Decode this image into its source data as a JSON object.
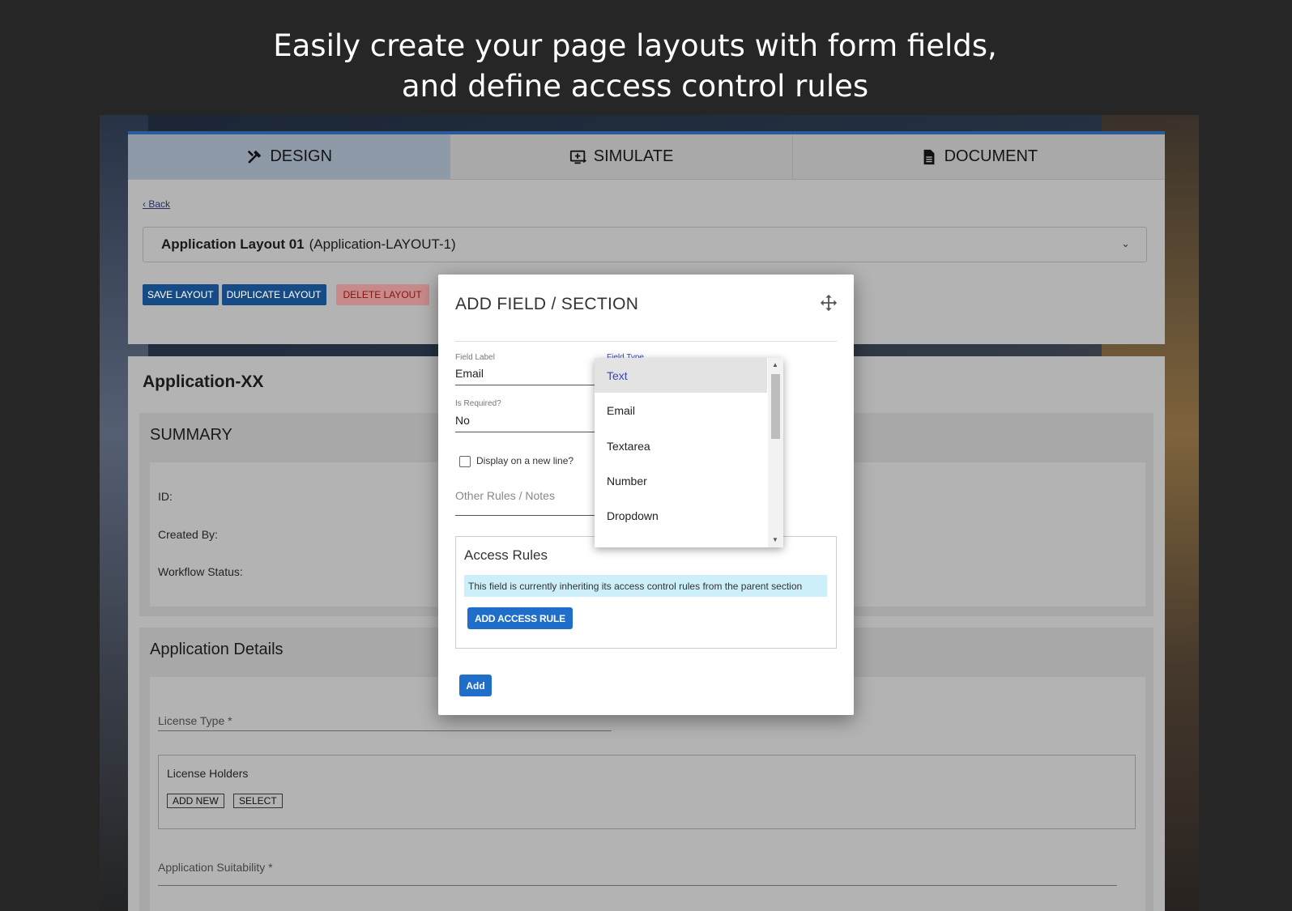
{
  "headline": {
    "line1": "Easily create your page layouts with form fields,",
    "line2": "and define access control rules"
  },
  "tabs": [
    {
      "label": "DESIGN",
      "icon": "design-tools-icon",
      "active": true
    },
    {
      "label": "SIMULATE",
      "icon": "simulate-screen-icon",
      "active": false
    },
    {
      "label": "DOCUMENT",
      "icon": "document-icon",
      "active": false
    }
  ],
  "back_link": "‹ Back",
  "layout_select": {
    "name": "Application Layout 01",
    "id": "(Application-LAYOUT-1)"
  },
  "layout_buttons": {
    "save": "SAVE LAYOUT",
    "duplicate": "DUPLICATE LAYOUT",
    "delete": "DELETE LAYOUT"
  },
  "application": {
    "title": "Application-XX",
    "summary": {
      "heading": "SUMMARY",
      "fields": [
        "ID:",
        "Created By:",
        "Workflow Status:"
      ]
    },
    "details": {
      "heading": "Application Details",
      "license_type": "License Type *",
      "license_holders": "License Holders",
      "add_new": "ADD NEW",
      "select": "SELECT",
      "suitability": "Application Suitability *"
    }
  },
  "modal": {
    "title": "ADD FIELD / SECTION",
    "field_label_caption": "Field Label",
    "field_label_value": "Email",
    "field_type_caption": "Field Type",
    "is_required_caption": "Is Required?",
    "is_required_value": "No",
    "new_line_label": "Display on a new line?",
    "notes_placeholder": "Other Rules / Notes",
    "access_rules_title": "Access Rules",
    "access_rules_info": "This field is currently inheriting its access control rules from the parent section",
    "add_access_rule": "ADD ACCESS RULE",
    "add_button": "Add"
  },
  "field_type_options": [
    "Text",
    "Email",
    "Textarea",
    "Number",
    "Dropdown"
  ],
  "selected_field_type": "Text",
  "colors": {
    "accent_blue": "#1f6ec9",
    "info_bg": "#cdeff9",
    "danger_text": "#8a1010"
  }
}
